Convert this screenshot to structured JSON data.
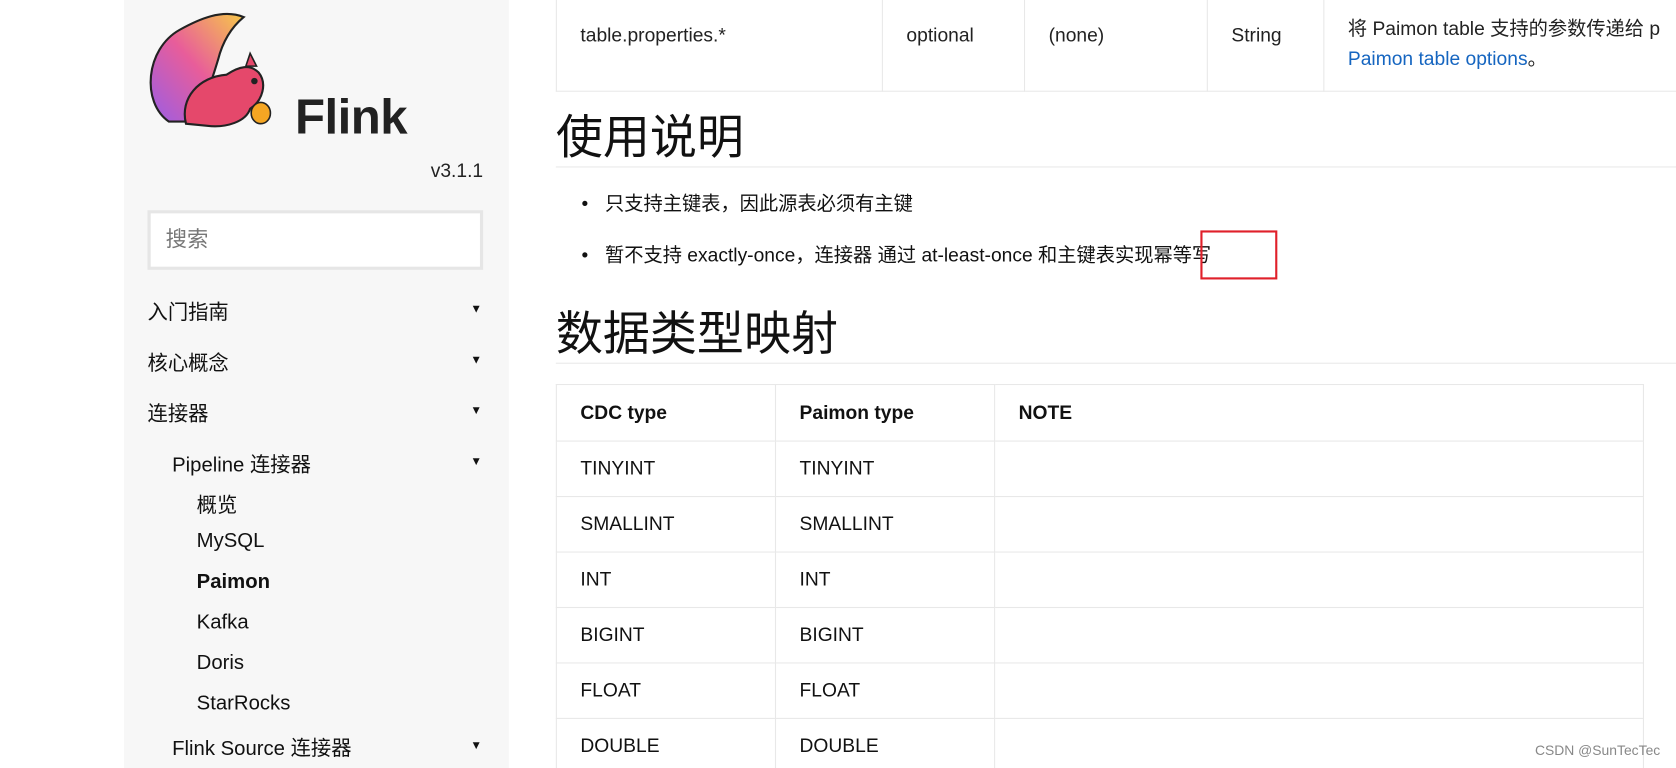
{
  "sidebar": {
    "logo_text": "Flink",
    "version": "v3.1.1",
    "search_placeholder": "搜索",
    "nav": [
      {
        "label": "入门指南",
        "expandable": true
      },
      {
        "label": "核心概念",
        "expandable": true
      },
      {
        "label": "连接器",
        "expandable": true
      },
      {
        "label": "Pipeline 连接器",
        "expandable": true
      },
      {
        "label": "概览",
        "expandable": false
      },
      {
        "label": "MySQL",
        "expandable": false
      },
      {
        "label": "Paimon",
        "expandable": false,
        "active": true
      },
      {
        "label": "Kafka",
        "expandable": false
      },
      {
        "label": "Doris",
        "expandable": false
      },
      {
        "label": "StarRocks",
        "expandable": false
      },
      {
        "label": "Flink Source 连接器",
        "expandable": true
      }
    ]
  },
  "options_table": {
    "row": {
      "option": "table.properties.*",
      "required": "optional",
      "default": "(none)",
      "type": "String",
      "description_prefix": "将 Paimon table 支持的参数传递给 p",
      "description_link": "Paimon table options",
      "description_suffix": "。"
    }
  },
  "usage": {
    "heading": "使用说明",
    "bullets": [
      "只支持主键表，因此源表必须有主键",
      "暂不支持 exactly-once，连接器 通过 at-least-once 和主键表实现幂等写"
    ],
    "highlighted_text": "幂等写"
  },
  "type_mapping": {
    "heading": "数据类型映射",
    "columns": [
      "CDC type",
      "Paimon type",
      "NOTE"
    ],
    "rows": [
      [
        "TINYINT",
        "TINYINT",
        ""
      ],
      [
        "SMALLINT",
        "SMALLINT",
        ""
      ],
      [
        "INT",
        "INT",
        ""
      ],
      [
        "BIGINT",
        "BIGINT",
        ""
      ],
      [
        "FLOAT",
        "FLOAT",
        ""
      ],
      [
        "DOUBLE",
        "DOUBLE",
        ""
      ]
    ]
  },
  "watermark": "CSDN @SunTecTec",
  "colors": {
    "link": "#1565c0",
    "highlight_box": "#e0202a",
    "sidebar_bg": "#f7f7f7"
  }
}
